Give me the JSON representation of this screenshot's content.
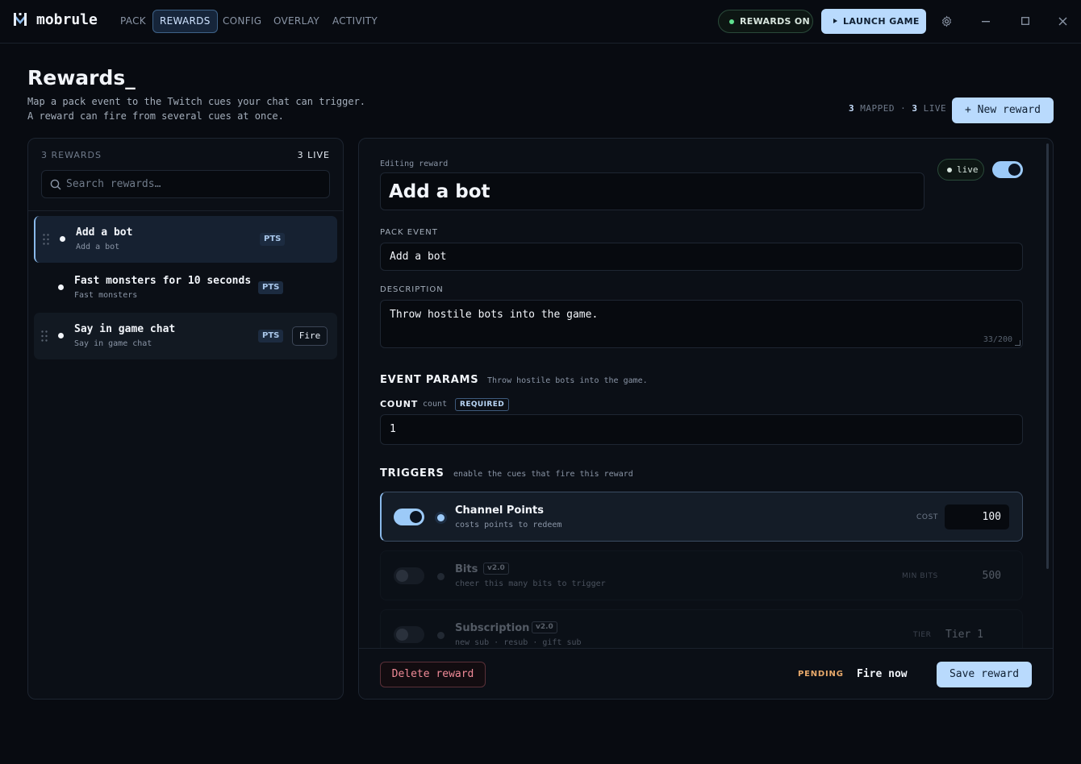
{
  "app": {
    "brand": "mobrule",
    "tabs": [
      "PACK",
      "REWARDS",
      "CONFIG",
      "OVERLAY",
      "ACTIVITY"
    ],
    "active_tab": "REWARDS",
    "rewards_pill": "REWARDS ON",
    "launch_label": "LAUNCH GAME"
  },
  "page": {
    "title": "Rewards_",
    "description": "Map a pack event to the Twitch cues your chat can trigger. A reward can fire from several cues at once.",
    "mapped_count": "3",
    "mapped_label": "MAPPED",
    "separator": "·",
    "live_count": "3",
    "live_label": "LIVE",
    "new_reward_label": "+ New reward"
  },
  "list": {
    "count_label": "3 REWARDS",
    "live_label": "3 LIVE",
    "search_placeholder": "Search rewards…",
    "items": [
      {
        "title": "Add a bot",
        "subtitle": "Add a bot",
        "badge": "PTS",
        "active": true
      },
      {
        "title": "Fast monsters for 10 seconds",
        "subtitle": "Fast monsters",
        "badge": "PTS"
      },
      {
        "title": "Say in game chat",
        "subtitle": "Say in game chat",
        "badge": "PTS",
        "action": "Fire"
      }
    ]
  },
  "editor": {
    "editing_label": "Editing reward",
    "title_value": "Add a bot",
    "live_label": "live",
    "pack_event_label": "PACK EVENT",
    "pack_event_value": "Add a bot",
    "description_label": "DESCRIPTION",
    "description_value": "Throw hostile bots into the game.",
    "char_count": "33/200",
    "params_heading": "EVENT PARAMS",
    "params_sub": "Throw hostile bots into the game.",
    "param_name": "COUNT",
    "param_key": "count",
    "param_required": "REQUIRED",
    "param_value": "1",
    "triggers_heading": "TRIGGERS",
    "triggers_sub": "enable the cues that fire this reward",
    "triggers": [
      {
        "title": "Channel Points",
        "subtitle": "costs points to redeem",
        "field_label": "COST",
        "value": "100",
        "enabled": true
      },
      {
        "title": "Bits",
        "version": "v2.0",
        "subtitle": "cheer this many bits to trigger",
        "field_label": "MIN BITS",
        "value": "500",
        "enabled": false
      },
      {
        "title": "Subscription",
        "version": "v2.0",
        "subtitle": "new sub · resub · gift sub",
        "field_label": "TIER",
        "value": "Tier 1",
        "enabled": false
      }
    ],
    "delete_label": "Delete reward",
    "status": "PENDING",
    "fire_now_label": "Fire now",
    "save_label": "Save reward"
  },
  "colors": {
    "accent": "#b9dafd",
    "live_green": "#5fe08f",
    "danger": "#f08a97",
    "pending": "#e8a96b",
    "background": "#080b11"
  }
}
